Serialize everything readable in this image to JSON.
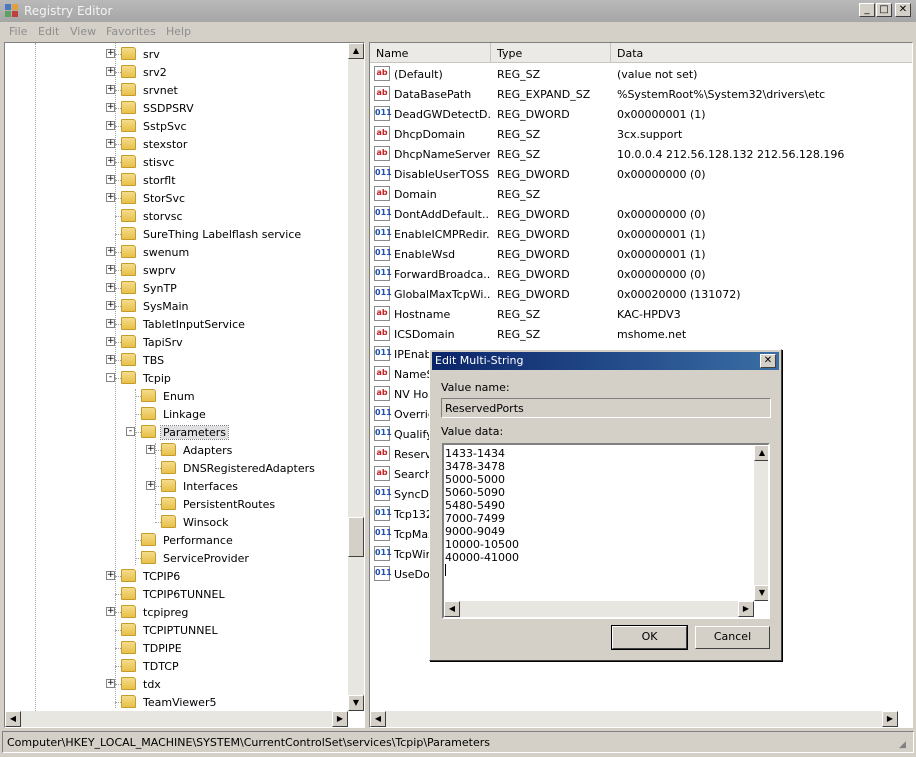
{
  "window": {
    "title": "Registry Editor"
  },
  "menu": [
    "File",
    "Edit",
    "View",
    "Favorites",
    "Help"
  ],
  "tree": {
    "items": [
      {
        "label": "srv",
        "expander": "+",
        "level": 0
      },
      {
        "label": "srv2",
        "expander": "+",
        "level": 0
      },
      {
        "label": "srvnet",
        "expander": "+",
        "level": 0
      },
      {
        "label": "SSDPSRV",
        "expander": "+",
        "level": 0
      },
      {
        "label": "SstpSvc",
        "expander": "+",
        "level": 0
      },
      {
        "label": "stexstor",
        "expander": "+",
        "level": 0
      },
      {
        "label": "stisvc",
        "expander": "+",
        "level": 0
      },
      {
        "label": "storflt",
        "expander": "+",
        "level": 0
      },
      {
        "label": "StorSvc",
        "expander": "+",
        "level": 0
      },
      {
        "label": "storvsc",
        "expander": "",
        "level": 0
      },
      {
        "label": "SureThing Labelflash service",
        "expander": "",
        "level": 0
      },
      {
        "label": "swenum",
        "expander": "+",
        "level": 0
      },
      {
        "label": "swprv",
        "expander": "+",
        "level": 0
      },
      {
        "label": "SynTP",
        "expander": "+",
        "level": 0
      },
      {
        "label": "SysMain",
        "expander": "+",
        "level": 0
      },
      {
        "label": "TabletInputService",
        "expander": "+",
        "level": 0
      },
      {
        "label": "TapiSrv",
        "expander": "+",
        "level": 0
      },
      {
        "label": "TBS",
        "expander": "+",
        "level": 0
      },
      {
        "label": "Tcpip",
        "expander": "-",
        "level": 0
      },
      {
        "label": "Enum",
        "expander": "",
        "level": 1
      },
      {
        "label": "Linkage",
        "expander": "",
        "level": 1
      },
      {
        "label": "Parameters",
        "expander": "-",
        "level": 1,
        "selected": true
      },
      {
        "label": "Adapters",
        "expander": "+",
        "level": 2
      },
      {
        "label": "DNSRegisteredAdapters",
        "expander": "",
        "level": 2
      },
      {
        "label": "Interfaces",
        "expander": "+",
        "level": 2
      },
      {
        "label": "PersistentRoutes",
        "expander": "",
        "level": 2
      },
      {
        "label": "Winsock",
        "expander": "",
        "level": 2
      },
      {
        "label": "Performance",
        "expander": "",
        "level": 1
      },
      {
        "label": "ServiceProvider",
        "expander": "",
        "level": 1
      },
      {
        "label": "TCPIP6",
        "expander": "+",
        "level": 0
      },
      {
        "label": "TCPIP6TUNNEL",
        "expander": "",
        "level": 0
      },
      {
        "label": "tcpipreg",
        "expander": "+",
        "level": 0
      },
      {
        "label": "TCPIPTUNNEL",
        "expander": "",
        "level": 0
      },
      {
        "label": "TDPIPE",
        "expander": "",
        "level": 0
      },
      {
        "label": "TDTCP",
        "expander": "",
        "level": 0
      },
      {
        "label": "tdx",
        "expander": "+",
        "level": 0
      },
      {
        "label": "TeamViewer5",
        "expander": "",
        "level": 0
      }
    ]
  },
  "list": {
    "headers": {
      "name": "Name",
      "type": "Type",
      "data": "Data"
    },
    "rows": [
      {
        "icon": "ab",
        "name": "(Default)",
        "type": "REG_SZ",
        "data": "(value not set)"
      },
      {
        "icon": "ab",
        "name": "DataBasePath",
        "type": "REG_EXPAND_SZ",
        "data": "%SystemRoot%\\System32\\drivers\\etc"
      },
      {
        "icon": "dw",
        "name": "DeadGWDetectD...",
        "type": "REG_DWORD",
        "data": "0x00000001 (1)"
      },
      {
        "icon": "ab",
        "name": "DhcpDomain",
        "type": "REG_SZ",
        "data": "3cx.support"
      },
      {
        "icon": "ab",
        "name": "DhcpNameServer",
        "type": "REG_SZ",
        "data": "10.0.0.4 212.56.128.132 212.56.128.196"
      },
      {
        "icon": "dw",
        "name": "DisableUserTOSS...",
        "type": "REG_DWORD",
        "data": "0x00000000 (0)"
      },
      {
        "icon": "ab",
        "name": "Domain",
        "type": "REG_SZ",
        "data": ""
      },
      {
        "icon": "dw",
        "name": "DontAddDefault...",
        "type": "REG_DWORD",
        "data": "0x00000000 (0)"
      },
      {
        "icon": "dw",
        "name": "EnableICMPRedir...",
        "type": "REG_DWORD",
        "data": "0x00000001 (1)"
      },
      {
        "icon": "dw",
        "name": "EnableWsd",
        "type": "REG_DWORD",
        "data": "0x00000001 (1)"
      },
      {
        "icon": "dw",
        "name": "ForwardBroadca...",
        "type": "REG_DWORD",
        "data": "0x00000000 (0)"
      },
      {
        "icon": "dw",
        "name": "GlobalMaxTcpWi...",
        "type": "REG_DWORD",
        "data": "0x00020000 (131072)"
      },
      {
        "icon": "ab",
        "name": "Hostname",
        "type": "REG_SZ",
        "data": "KAC-HPDV3"
      },
      {
        "icon": "ab",
        "name": "ICSDomain",
        "type": "REG_SZ",
        "data": "mshome.net"
      },
      {
        "icon": "dw",
        "name": "IPEnab",
        "type": "",
        "data": ""
      },
      {
        "icon": "ab",
        "name": "NameSe",
        "type": "",
        "data": ""
      },
      {
        "icon": "ab",
        "name": "NV Hos",
        "type": "",
        "data": ""
      },
      {
        "icon": "dw",
        "name": "Overric",
        "type": "",
        "data": ""
      },
      {
        "icon": "dw",
        "name": "Qualify",
        "type": "",
        "data": ""
      },
      {
        "icon": "ab",
        "name": "Reserve",
        "type": "",
        "data": "5060-5090 5480-5490 700"
      },
      {
        "icon": "ab",
        "name": "Search",
        "type": "",
        "data": ""
      },
      {
        "icon": "dw",
        "name": "SyncDo",
        "type": "",
        "data": ""
      },
      {
        "icon": "dw",
        "name": "Tcp132",
        "type": "",
        "data": ""
      },
      {
        "icon": "dw",
        "name": "TcpMax",
        "type": "",
        "data": ""
      },
      {
        "icon": "dw",
        "name": "TcpWir",
        "type": "",
        "data": ""
      },
      {
        "icon": "dw",
        "name": "UseDon",
        "type": "",
        "data": ""
      }
    ]
  },
  "status": "Computer\\HKEY_LOCAL_MACHINE\\SYSTEM\\CurrentControlSet\\services\\Tcpip\\Parameters",
  "dialog": {
    "title": "Edit Multi-String",
    "value_name_label": "Value name:",
    "value_name": "ReservedPorts",
    "value_data_label": "Value data:",
    "value_data_lines": [
      "1433-1434",
      "3478-3478",
      "5000-5000",
      "5060-5090",
      "5480-5490",
      "7000-7499",
      "9000-9049",
      "10000-10500",
      "40000-41000"
    ],
    "ok_label": "OK",
    "cancel_label": "Cancel",
    "close_glyph": "✕"
  },
  "caption_buttons": {
    "minimize": "_",
    "maximize": "□",
    "close": "✕"
  },
  "icons": {
    "string_value": "ab",
    "dword_value": "011"
  }
}
